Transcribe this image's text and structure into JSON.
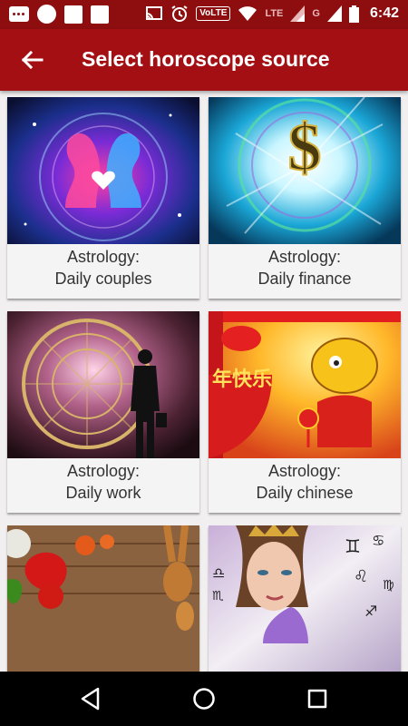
{
  "status_bar": {
    "time": "6:42",
    "volte_label": "VoLTE",
    "lte_label": "LTE",
    "g_label": "G",
    "icons": [
      "message-icon",
      "circle-notification-icon",
      "square-notification-icon",
      "square-notification-icon",
      "cast-icon",
      "alarm-icon",
      "volte-icon",
      "wifi-icon",
      "signal-icon",
      "signal-icon",
      "battery-icon"
    ]
  },
  "app_bar": {
    "title": "Select horoscope source",
    "back_icon": "arrow-back-icon"
  },
  "cards": [
    {
      "line1": "Astrology:",
      "line2": "Daily couples",
      "image": "couple-zodiac-image"
    },
    {
      "line1": "Astrology:",
      "line2": "Daily finance",
      "image": "dollar-zodiac-image"
    },
    {
      "line1": "Astrology:",
      "line2": "Daily work",
      "image": "businessman-zodiac-image"
    },
    {
      "line1": "Astrology:",
      "line2": "Daily chinese",
      "image": "chinese-dragon-image"
    },
    {
      "line1": "",
      "line2": "",
      "image": "vegetables-food-image"
    },
    {
      "line1": "",
      "line2": "",
      "image": "woman-zodiac-image"
    }
  ],
  "nav_bar": {
    "icons": [
      "back-triangle-icon",
      "home-circle-icon",
      "recents-square-icon"
    ]
  },
  "colors": {
    "status_bar": "#8e0e10",
    "app_bar": "#a30f13",
    "background": "#f1efef"
  }
}
